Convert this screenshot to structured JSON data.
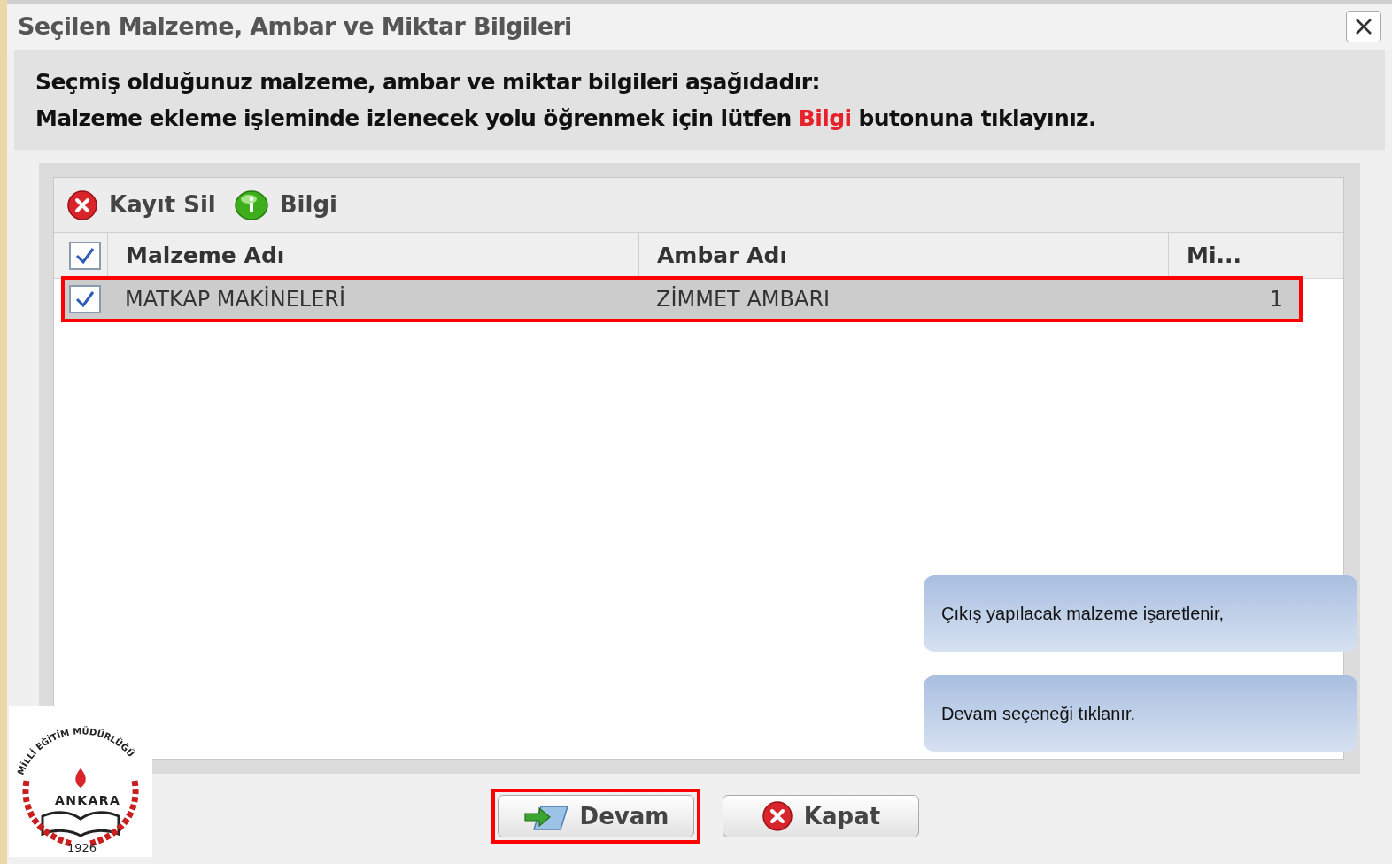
{
  "window": {
    "title": "Seçilen Malzeme, Ambar ve Miktar Bilgileri"
  },
  "instructions": {
    "line_1": "Seçmiş olduğunuz malzeme, ambar ve miktar bilgileri aşağıdadır:",
    "line_2": {
      "before": "Malzeme ekleme işleminde izlenecek yolu öğrenmek için lütfen",
      "highlight": "Bilgi",
      "after": "butonuna tıklayınız."
    }
  },
  "toolbar": [
    {
      "kind": "delete",
      "label": "Kayıt Sil"
    },
    {
      "kind": "info",
      "label": "Bilgi"
    }
  ],
  "table": {
    "header_checked": true,
    "columns": [
      {
        "label": "Malzeme Adı"
      },
      {
        "label": "Ambar Adı"
      },
      {
        "label": "Mi..."
      }
    ],
    "rows": [
      {
        "checked": true,
        "selected": true,
        "annotated": true,
        "cells": [
          "MATKAP MAKİNELERİ",
          "ZİMMET AMBARI",
          "1"
        ]
      }
    ]
  },
  "callouts": [
    "Çıkış yapılacak malzeme işaretlenir,",
    "Devam seçeneği tıklanır."
  ],
  "buttons": [
    {
      "kind": "continue",
      "label": "Devam",
      "annotated": true
    },
    {
      "kind": "close",
      "label": "Kapat",
      "annotated": false
    }
  ],
  "logo": {
    "arc_text": "MİLLİ EĞİTİM MÜDÜRLÜĞÜ",
    "center_text": "ANKARA",
    "year": "1926"
  }
}
